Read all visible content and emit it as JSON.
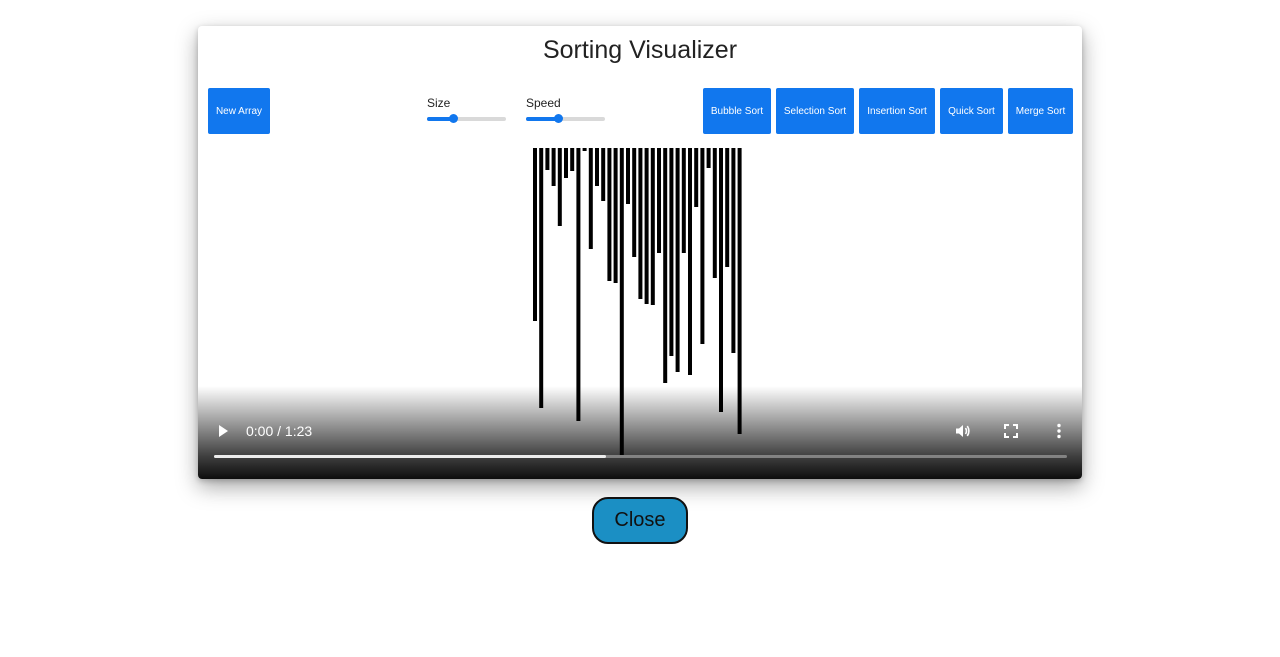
{
  "app": {
    "title": "Sorting Visualizer"
  },
  "toolbar": {
    "new_array_label": "New Array",
    "size_label": "Size",
    "size_value": 0.33,
    "speed_label": "Speed",
    "speed_value": 0.4,
    "algorithms": [
      "Bubble Sort",
      "Selection Sort",
      "Insertion Sort",
      "Quick Sort",
      "Merge Sort"
    ]
  },
  "chart_data": {
    "type": "bar",
    "orientation": "downward",
    "bar_color": "#000000",
    "values": [
      173,
      260,
      22,
      38,
      78,
      30,
      23,
      273,
      3,
      101,
      38,
      53,
      133,
      135,
      307,
      56,
      109,
      151,
      156,
      157,
      105,
      235,
      208,
      224,
      105,
      227,
      59,
      196,
      20,
      130,
      264,
      119,
      205,
      286
    ]
  },
  "video": {
    "current_time": "0:00",
    "duration": "1:23",
    "time_text": "0:00 / 1:23",
    "buffered_fraction": 0.46,
    "play_icon": "play-icon",
    "volume_icon": "volume-icon",
    "fullscreen_icon": "fullscreen-icon",
    "more_icon": "more-options-icon"
  },
  "dialog": {
    "close_label": "Close",
    "close_color": "#1b8fc4"
  },
  "colors": {
    "accent": "#1177ee"
  }
}
